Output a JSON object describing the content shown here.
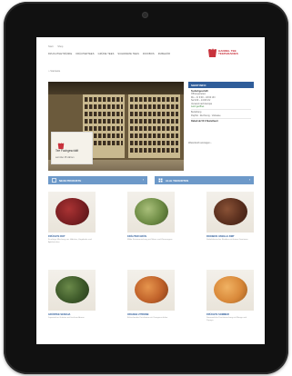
{
  "site": {
    "breadcrumb": [
      "Start",
      "Shop"
    ],
    "nav_items": [
      "Fruchtgetränke",
      "Kräutertees",
      "Grüne Tees",
      "Schwarze Tees",
      "Rooibos",
      "Zubehör"
    ],
    "home_link": "Startseite",
    "brand_name": "HANDEL TEE\nTEEPARADIES",
    "brand_color": "#c8323c",
    "accent_color": "#2f5d9a"
  },
  "hero": {
    "sign_title": "Tee Fachgeschäft",
    "sign_subtitle": "seit über 25 Jahren"
  },
  "sidebar": {
    "header": "SHOP INFO",
    "rows": [
      {
        "text": "Teefachgeschäft",
        "style": "bold"
      },
      {
        "text": "Öffnungszeiten",
        "style": "normal"
      },
      {
        "text": "Mo – Fr 9:00 – 18:00 Uhr",
        "style": "normal"
      },
      {
        "text": "Sa 9:00 – 14:00 Uhr",
        "style": "normal"
      },
      {
        "text": "Versand nach Europa",
        "style": "normal"
      },
      {
        "text": "Jetzt geöffnet",
        "style": "green"
      },
      {
        "text": "Bezahlung",
        "style": "normal"
      },
      {
        "text": "PayPal · Rechnung · Vorkasse",
        "style": "normal"
      },
      {
        "text": "Rabatt ab 50 € Bestellwert",
        "style": "bold"
      }
    ],
    "note": "Warenkorb anzeigen ›"
  },
  "categories": [
    {
      "label": "Neue Produkte",
      "arrow": "›"
    },
    {
      "label": "Alle Teesorten",
      "arrow": "›"
    }
  ],
  "products": [
    {
      "name": "Früchte Rot",
      "desc": "Fruchtige Mischung aus Hibiskus, Hagebutte und Apfelstücken",
      "color": "#7a1f22"
    },
    {
      "name": "Kräuter Grün",
      "desc": "Milde Kräutermischung mit Minze und Zitronengras",
      "color": "#6e8c45"
    },
    {
      "name": "Rooibos Vanille Zimt",
      "desc": "Südafrikanischer Rooibos mit feinen Gewürzen",
      "color": "#5a2f1e"
    },
    {
      "name": "Grüntee Sencha",
      "desc": "Japanischer Grüntee mit frischem Aroma",
      "color": "#3e5a2a"
    },
    {
      "name": "Orange Zitrone",
      "desc": "Erfrischender Früchtetee mit Orangenschalen",
      "color": "#c0622a"
    },
    {
      "name": "Früchte Sommer",
      "desc": "Sommerliche Fruchtmischung mit Mango und Papaya",
      "color": "#d9893a"
    }
  ]
}
